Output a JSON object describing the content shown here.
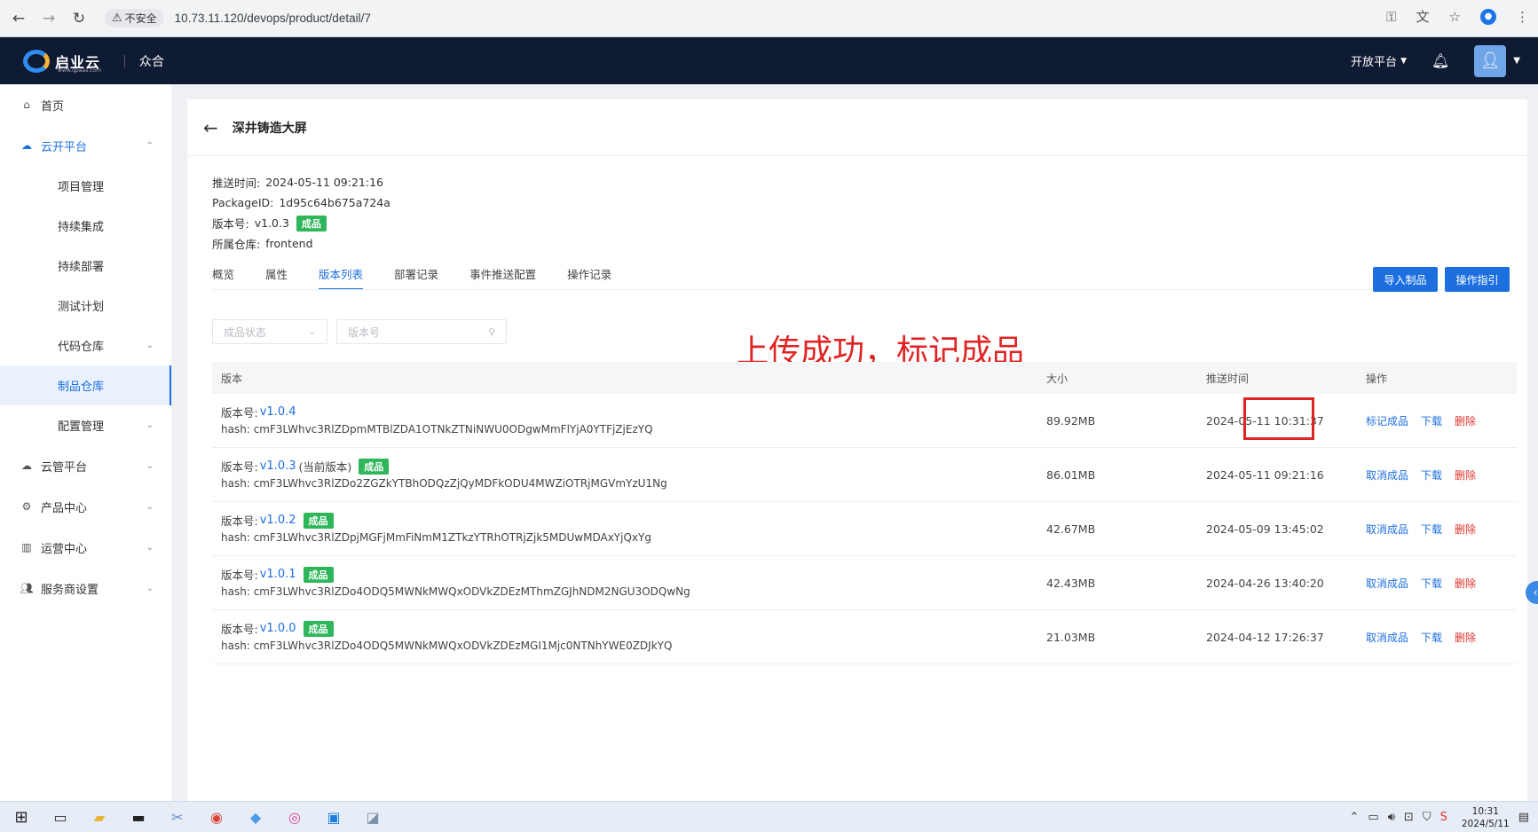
{
  "browser": {
    "insecure_label": "不安全",
    "url": "10.73.11.120/devops/product/detail/7"
  },
  "header": {
    "logo_text": "启业云",
    "logo_sub": "www.qpaas.com",
    "org": "众合",
    "open_platform": "开放平台"
  },
  "sidebar": {
    "items": [
      {
        "label": "首页"
      },
      {
        "label": "云开平台"
      },
      {
        "label": "项目管理"
      },
      {
        "label": "持续集成"
      },
      {
        "label": "持续部署"
      },
      {
        "label": "测试计划"
      },
      {
        "label": "代码仓库"
      },
      {
        "label": "制品仓库"
      },
      {
        "label": "配置管理"
      },
      {
        "label": "云管平台"
      },
      {
        "label": "产品中心"
      },
      {
        "label": "运营中心"
      },
      {
        "label": "服务商设置"
      }
    ]
  },
  "page": {
    "title": "深井铸造大屏",
    "info": {
      "push_time_label": "推送时间:",
      "push_time": "2024-05-11 09:21:16",
      "package_label": "PackageID:",
      "package_id": "1d95c64b675a724a",
      "version_label": "版本号:",
      "version": "v1.0.3",
      "version_tag": "成品",
      "repo_label": "所属仓库:",
      "repo": "frontend"
    },
    "tabs": [
      "概览",
      "属性",
      "版本列表",
      "部署记录",
      "事件推送配置",
      "操作记录"
    ],
    "buttons": {
      "import": "导入制品",
      "guide": "操作指引"
    },
    "filters": {
      "status_placeholder": "成品状态",
      "version_placeholder": "版本号"
    },
    "annotation": "上传成功，标记成品"
  },
  "table": {
    "headers": {
      "version": "版本",
      "size": "大小",
      "time": "推送时间",
      "ops": "操作"
    },
    "version_prefix": "版本号:",
    "hash_prefix": "hash:",
    "tag": "成品",
    "ops": {
      "mark": "标记成品",
      "unmark": "取消成品",
      "download": "下载",
      "delete": "删除"
    },
    "rows": [
      {
        "version": "v1.0.4",
        "current": "",
        "hash": "cmF3LWhvc3RlZDpmMTBlZDA1OTNkZTNiNWU0ODgwMmFlYjA0YTFjZjEzYQ",
        "size": "89.92MB",
        "time": "2024-05-11 10:31:37"
      },
      {
        "version": "v1.0.3",
        "current": "(当前版本)",
        "hash": "cmF3LWhvc3RlZDo2ZGZkYTBhODQzZjQyMDFkODU4MWZiOTRjMGVmYzU1Ng",
        "size": "86.01MB",
        "time": "2024-05-11 09:21:16"
      },
      {
        "version": "v1.0.2",
        "current": "",
        "hash": "cmF3LWhvc3RlZDpjMGFjMmFiNmM1ZTkzYTRhOTRjZjk5MDUwMDAxYjQxYg",
        "size": "42.67MB",
        "time": "2024-05-09 13:45:02"
      },
      {
        "version": "v1.0.1",
        "current": "",
        "hash": "cmF3LWhvc3RlZDo4ODQ5MWNkMWQxODVkZDEzMThmZGJhNDM2NGU3ODQwNg",
        "size": "42.43MB",
        "time": "2024-04-26 13:40:20"
      },
      {
        "version": "v1.0.0",
        "current": "",
        "hash": "cmF3LWhvc3RlZDo4ODQ5MWNkMWQxODVkZDEzMGI1Mjc0NTNhYWE0ZDJkYQ",
        "size": "21.03MB",
        "time": "2024-04-12 17:26:37"
      }
    ]
  },
  "taskbar": {
    "time": "10:31",
    "date": "2024/5/11"
  }
}
